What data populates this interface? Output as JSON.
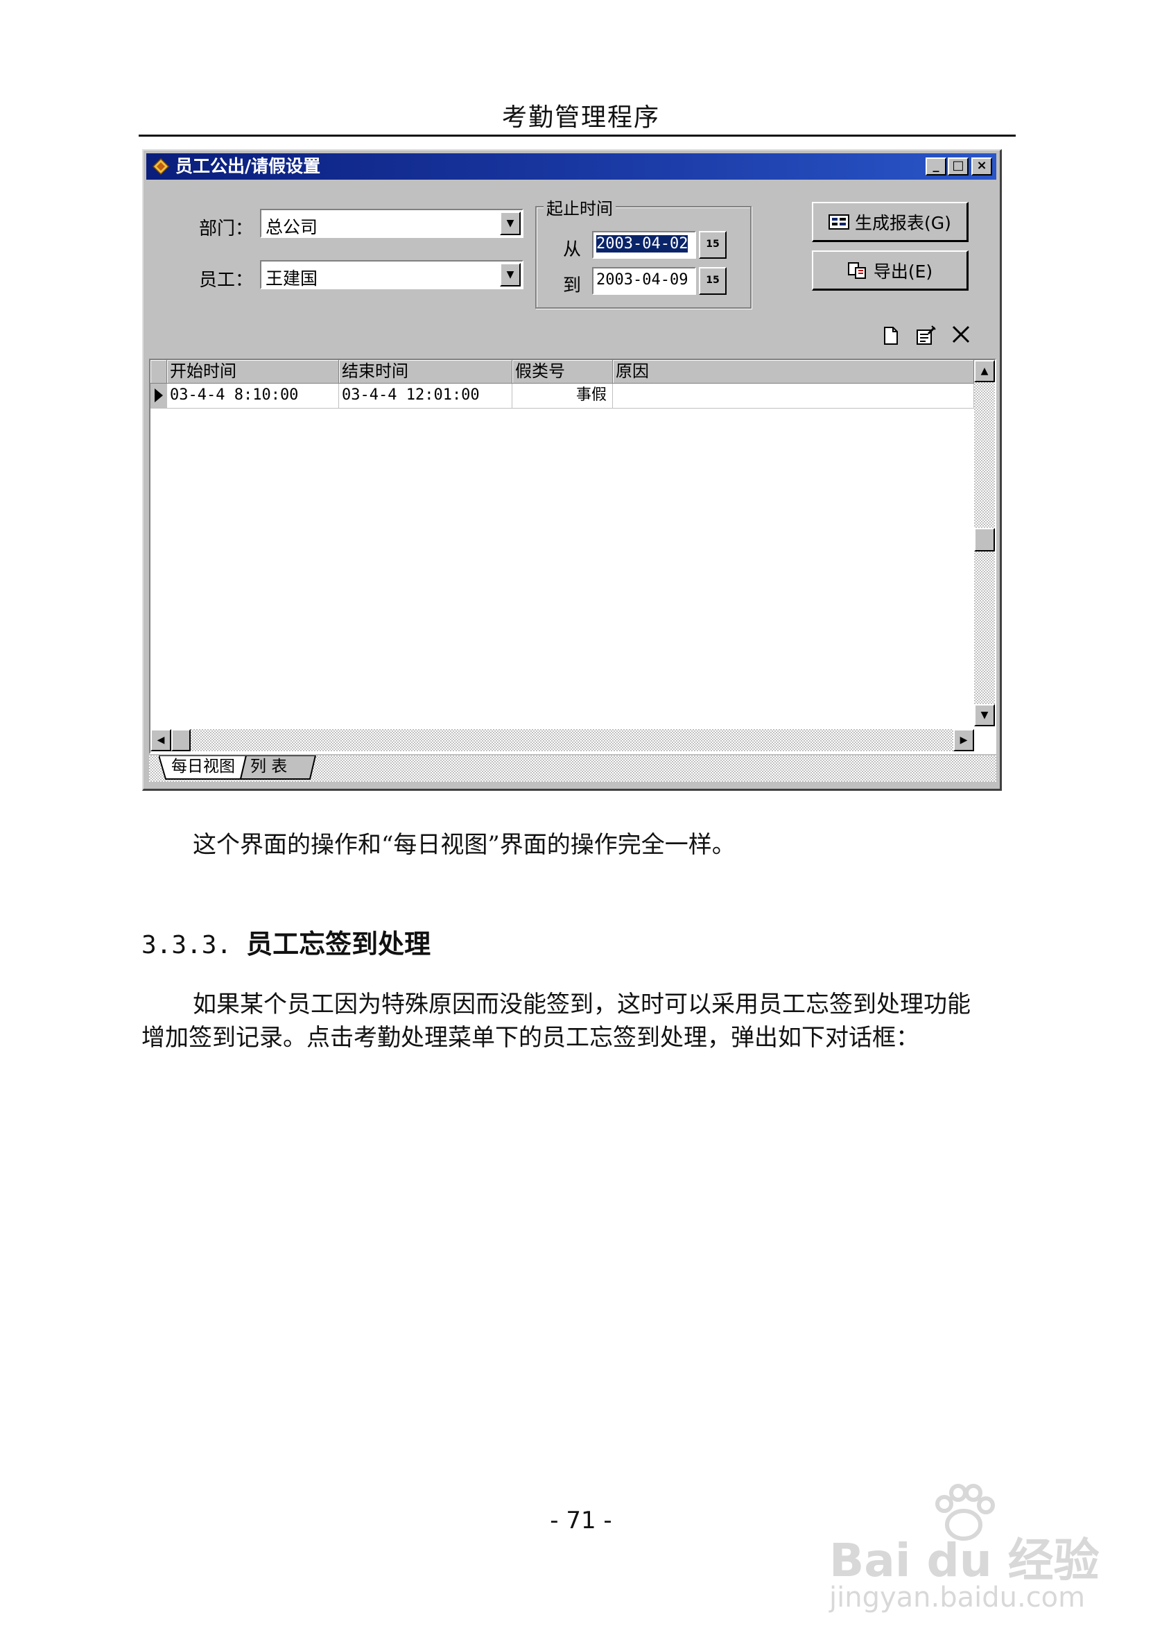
{
  "page": {
    "header": "考勤管理程序",
    "page_number": "- 71 -"
  },
  "dialog": {
    "title": "员工公出/请假设置",
    "window_buttons": {
      "minimize": "_",
      "maximize": "□",
      "close": "×"
    },
    "department_label": "部门：",
    "department_value": "总公司",
    "employee_label": "员工：",
    "employee_value": "王建国",
    "date_group_title": "起止时间",
    "from_label": "从",
    "from_date": "2003-04-02",
    "to_label": "到",
    "to_date": "2003-04-09",
    "calendar_button": "15",
    "generate_button": "生成报表(G)",
    "export_button": "导出(E)",
    "grid": {
      "columns": [
        "开始时间",
        "结束时间",
        "假类号",
        "原因"
      ],
      "rows": [
        {
          "start": "03-4-4 8:10:00",
          "end": "03-4-4 12:01:00",
          "type": "事假",
          "reason": ""
        }
      ]
    },
    "tabs": [
      "每日视图",
      "列 表"
    ]
  },
  "body": {
    "para1": "这个界面的操作和“每日视图”界面的操作完全一样。",
    "section_number": "3.3.3.",
    "section_title": "员工忘签到处理",
    "para2_line1": "如果某个员工因为特殊原因而没能签到，这时可以采用员工忘签到处理功能",
    "para2_line2": "增加签到记录。点击考勤处理菜单下的员工忘签到处理，弹出如下对话框："
  },
  "watermark": {
    "brand": "Bai du 经验",
    "url": "jingyan.baidu.com"
  }
}
